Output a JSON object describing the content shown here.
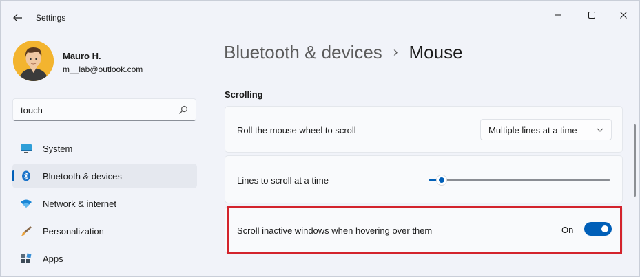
{
  "window": {
    "title": "Settings"
  },
  "user": {
    "name": "Mauro H.",
    "email": "m__lab@outlook.com"
  },
  "search": {
    "value": "touch"
  },
  "nav": {
    "items": [
      {
        "label": "System",
        "icon": "monitor-icon",
        "selected": false
      },
      {
        "label": "Bluetooth & devices",
        "icon": "bluetooth-icon",
        "selected": true
      },
      {
        "label": "Network & internet",
        "icon": "wifi-icon",
        "selected": false
      },
      {
        "label": "Personalization",
        "icon": "brush-icon",
        "selected": false
      },
      {
        "label": "Apps",
        "icon": "apps-icon",
        "selected": false
      }
    ]
  },
  "breadcrumb": {
    "parent": "Bluetooth & devices",
    "separator": "›",
    "current": "Mouse"
  },
  "section": {
    "title": "Scrolling"
  },
  "settings": {
    "wheel_scroll": {
      "label": "Roll the mouse wheel to scroll",
      "value": "Multiple lines at a time"
    },
    "lines_to_scroll": {
      "label": "Lines to scroll at a time",
      "slider_fraction": 0.04
    },
    "inactive_scroll": {
      "label": "Scroll inactive windows when hovering over them",
      "state_label": "On",
      "enabled": true
    }
  },
  "colors": {
    "accent": "#005fb8",
    "highlight_border": "#d3232c"
  }
}
